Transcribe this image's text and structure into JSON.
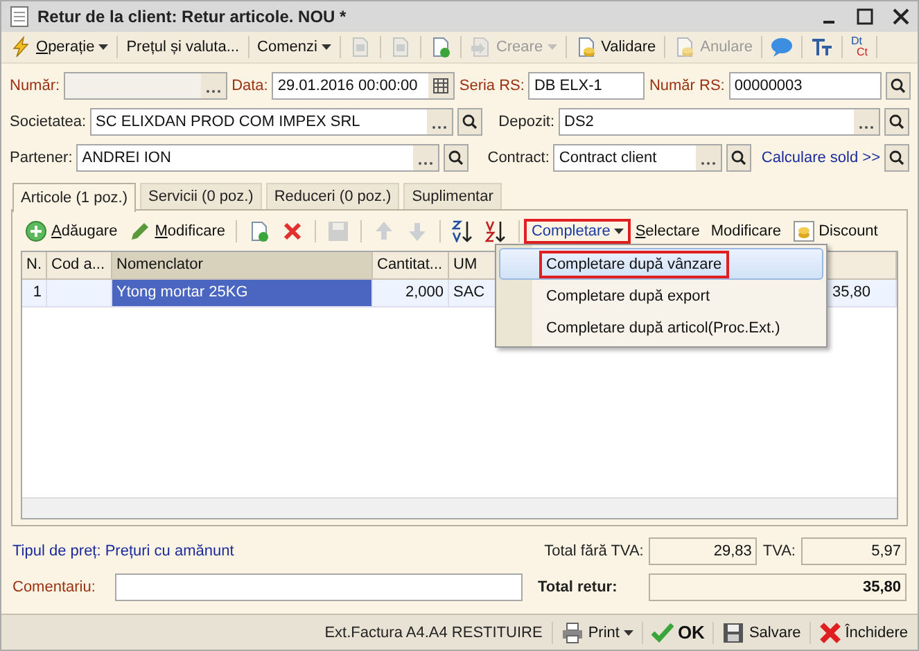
{
  "window": {
    "title": "Retur de la client: Retur articole. NOU *"
  },
  "toolbar": [
    {
      "kind": "dropdown",
      "label": "Operație",
      "mnemonic": true,
      "disabled": false
    },
    {
      "kind": "button",
      "label": "Prețul și valuta...",
      "mnemonic": false,
      "disabled": false
    },
    {
      "kind": "dropdown",
      "label": "Comenzi",
      "mnemonic": false,
      "disabled": false
    },
    {
      "kind": "icon",
      "disabled": true
    },
    {
      "kind": "icon",
      "disabled": true
    },
    {
      "kind": "icon",
      "disabled": false
    },
    {
      "kind": "dropdown",
      "label": "Creare",
      "mnemonic": false,
      "disabled": true
    },
    {
      "kind": "button",
      "label": "Validare",
      "mnemonic": false,
      "disabled": false
    },
    {
      "kind": "button",
      "label": "Anulare",
      "mnemonic": false,
      "disabled": true
    },
    {
      "kind": "icon",
      "disabled": false
    },
    {
      "kind": "icon",
      "disabled": false
    },
    {
      "kind": "dtct",
      "top": "Dt",
      "bottom": "Ct"
    }
  ],
  "form": {
    "numar": {
      "label": "Număr:"
    },
    "data": {
      "label": "Data:",
      "value": "29.01.2016 00:00:00"
    },
    "seria": {
      "label": "Seria RS:",
      "value": "DB ELX-1"
    },
    "numar_rs": {
      "label": "Număr RS:",
      "value": "00000003"
    },
    "societatea": {
      "label": "Societatea:",
      "value": "SC ELIXDAN PROD COM IMPEX SRL"
    },
    "depozit": {
      "label": "Depozit:",
      "value": "DS2"
    },
    "partener": {
      "label": "Partener:",
      "value": "ANDREI ION"
    },
    "contract": {
      "label": "Contract:",
      "value": "Contract client"
    },
    "sold_link": "Calculare sold >>"
  },
  "tabs": [
    {
      "label": "Articole (1 poz.)",
      "selected": true
    },
    {
      "label": "Servicii (0 poz.)",
      "selected": false
    },
    {
      "label": "Reduceri (0 poz.)",
      "selected": false
    },
    {
      "label": "Suplimentar",
      "selected": false
    }
  ],
  "grid_toolbar": [
    {
      "kind": "button",
      "label": "Adăugare",
      "mnemonic": true,
      "disabled": false,
      "highlighted": false
    },
    {
      "kind": "button",
      "label": "Modificare",
      "mnemonic": true,
      "disabled": false,
      "highlighted": false
    },
    {
      "kind": "icon",
      "disabled": false
    },
    {
      "kind": "icon",
      "disabled": false
    },
    {
      "kind": "icon",
      "disabled": true
    },
    {
      "kind": "icon",
      "disabled": true
    },
    {
      "kind": "icon",
      "disabled": true
    },
    {
      "kind": "icon",
      "disabled": false
    },
    {
      "kind": "icon",
      "disabled": false
    },
    {
      "kind": "dropdown",
      "label": "Completare",
      "mnemonic": false,
      "disabled": false,
      "highlighted": true
    },
    {
      "kind": "button",
      "label": "Selectare",
      "mnemonic": true,
      "disabled": false,
      "highlighted": false
    },
    {
      "kind": "button",
      "label": "Modificare",
      "mnemonic": false,
      "disabled": false,
      "highlighted": false
    },
    {
      "kind": "button",
      "label": "Discount",
      "mnemonic": false,
      "disabled": false,
      "highlighted": false
    }
  ],
  "dropdown_menu": [
    {
      "label": "Completare după vânzare",
      "selected": true,
      "highlighted": true
    },
    {
      "label": "Completare după export",
      "selected": false,
      "highlighted": false
    },
    {
      "label": "Completare după articol(Proc.Ext.)",
      "selected": false,
      "highlighted": false
    }
  ],
  "table": {
    "columns": [
      "N.",
      "Cod a...",
      "Nomenclator",
      "Cantitat...",
      "UM"
    ],
    "rows": [
      {
        "cells": [
          "1",
          "",
          "Ytong mortar 25KG",
          "2,000",
          "SAC"
        ],
        "amount": "35,80",
        "selected": true
      }
    ]
  },
  "price_type": {
    "label": "Tipul de preț:",
    "value": "Prețuri cu amănunt"
  },
  "comment": {
    "label": "Comentariu:"
  },
  "totals": {
    "net_label": "Total fără TVA:",
    "net": "29,83",
    "vat_label": "TVA:",
    "vat": "5,97",
    "total_label": "Total retur:",
    "total": "35,80"
  },
  "footer": [
    {
      "kind": "text",
      "label": "Ext.Factura A4.A4 RESTITUIRE"
    },
    {
      "kind": "dropdown",
      "label": "Print"
    },
    {
      "kind": "ok",
      "label": "OK"
    },
    {
      "kind": "button",
      "label": "Salvare"
    },
    {
      "kind": "button",
      "label": "Închidere"
    }
  ]
}
